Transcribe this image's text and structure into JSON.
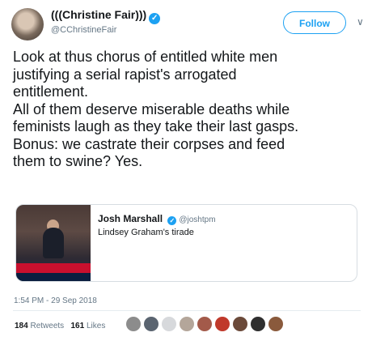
{
  "author": {
    "name": "(((Christine Fair)))",
    "handle": "@CChristineFair",
    "verified_icon": "verified-badge-icon"
  },
  "follow_label": "Follow",
  "caret_icon": "chevron-down-icon",
  "tweet_lines": [
    "Look at thus chorus of entitled white men",
    "justifying a serial rapist's arrogated",
    "entitlement.",
    "All of them deserve miserable deaths while",
    "feminists laugh as they take their last gasps.",
    "Bonus: we castrate their corpses and feed",
    "them to swine? Yes."
  ],
  "quoted": {
    "author": "Josh Marshall",
    "handle": "@joshtpm",
    "text": "Lindsey Graham's tirade"
  },
  "timestamp": "1:54 PM - 29 Sep 2018",
  "stats": {
    "retweets_count": "184",
    "retweets_label": "Retweets",
    "likes_count": "161",
    "likes_label": "Likes"
  },
  "liker_avatar_colors": [
    "#8c8c8c",
    "#5a6470",
    "#d7d9dc",
    "#b4a69a",
    "#a35a4a",
    "#c0392b",
    "#6b4a3a",
    "#2f2f2f",
    "#8a5a3c"
  ],
  "accent_color": "#1da1f2"
}
